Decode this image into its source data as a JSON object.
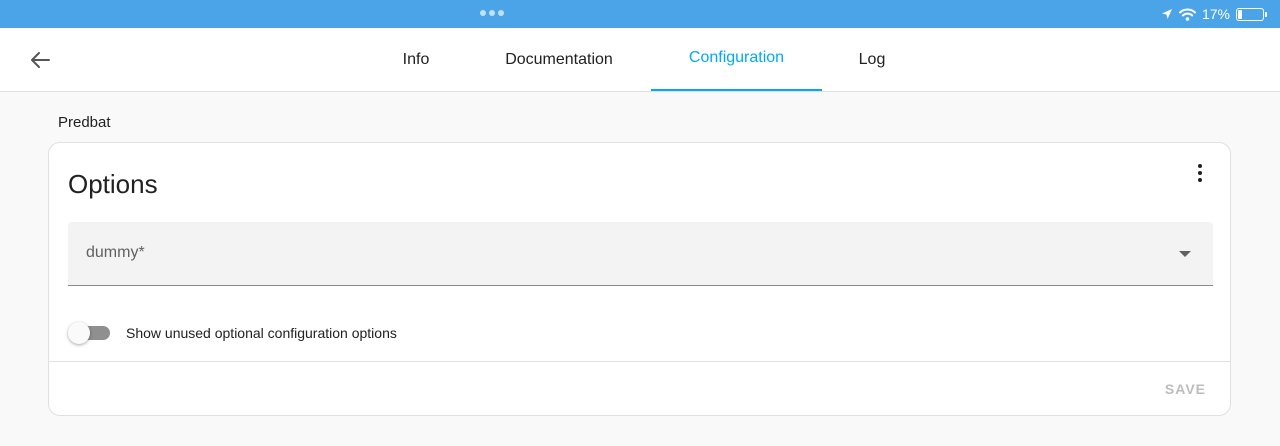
{
  "status_bar": {
    "battery_percent_label": "17%",
    "battery_level": 0.17,
    "icons": [
      "location-arrow-icon",
      "wifi-icon",
      "battery-icon"
    ]
  },
  "nav": {
    "back_icon": "arrow-left-icon",
    "tabs": [
      {
        "label": "Info",
        "active": false
      },
      {
        "label": "Documentation",
        "active": false
      },
      {
        "label": "Configuration",
        "active": true
      },
      {
        "label": "Log",
        "active": false
      }
    ]
  },
  "addon": {
    "name": "Predbat"
  },
  "card": {
    "title": "Options",
    "menu_icon": "more-vertical-icon",
    "select": {
      "label": "dummy*",
      "icon": "dropdown-arrow-icon"
    },
    "toggle": {
      "label": "Show unused optional configuration options",
      "checked": false
    },
    "save_label": "SAVE"
  },
  "colors": {
    "status_bar": "#4ca4e8",
    "accent": "#03a9f4",
    "text": "#212121",
    "disabled": "#bdbdbd"
  }
}
